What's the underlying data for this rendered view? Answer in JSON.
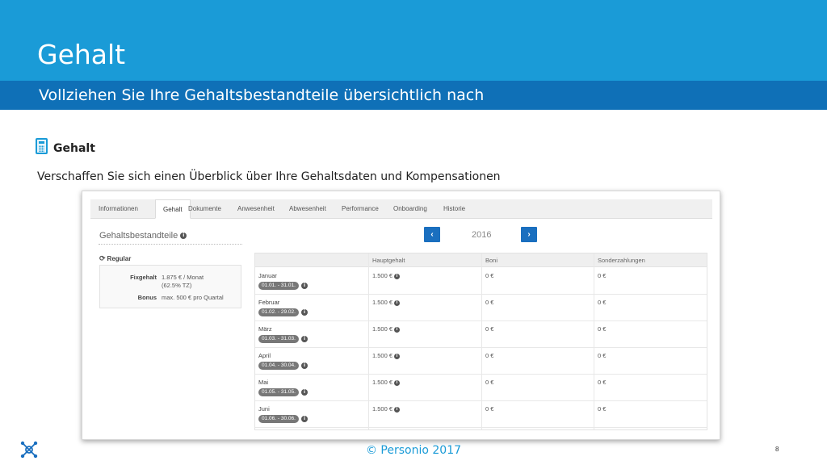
{
  "slide": {
    "title": "Gehalt",
    "subtitle": "Vollziehen Sie Ihre Gehaltsbestandteile übersichtlich nach",
    "section_heading": "Gehalt",
    "section_description": "Verschaffen Sie sich einen Überblick über Ihre Gehaltsdaten und Kompensationen",
    "footer": "© Personio 2017",
    "page_number": "8"
  },
  "colors": {
    "header": "#1a9bd7",
    "subheader": "#0f70b7",
    "nav_button": "#1a6fbf",
    "footer_text": "#1a9bd7"
  },
  "screenshot": {
    "tabs": [
      "Informationen",
      "Gehalt",
      "Dokumente",
      "Anwesenheit",
      "Abwesenheit",
      "Performance",
      "Onboarding",
      "Historie"
    ],
    "active_tab": "Gehalt",
    "panel_title": "Gehaltsbestandteile",
    "regular_label": "Regular",
    "fixgehalt_label": "Fixgehalt",
    "fixgehalt_value": "1.875 € / Monat",
    "fixgehalt_note": "(62.5% TZ)",
    "bonus_label": "Bonus",
    "bonus_value": "max. 500 € pro Quartal",
    "year": "2016",
    "prev_symbol": "‹",
    "next_symbol": "›",
    "columns": [
      "Hauptgehalt",
      "Boni",
      "Sonderzahlungen"
    ],
    "rows": [
      {
        "month": "Januar",
        "range": "01.01. - 31.01.",
        "hauptgehalt": "1.500 €",
        "boni": "0 €",
        "sonder": "0 €"
      },
      {
        "month": "Februar",
        "range": "01.02. - 29.02.",
        "hauptgehalt": "1.500 €",
        "boni": "0 €",
        "sonder": "0 €"
      },
      {
        "month": "März",
        "range": "01.03. - 31.03.",
        "hauptgehalt": "1.500 €",
        "boni": "0 €",
        "sonder": "0 €"
      },
      {
        "month": "April",
        "range": "01.04. - 30.04.",
        "hauptgehalt": "1.500 €",
        "boni": "0 €",
        "sonder": "0 €"
      },
      {
        "month": "Mai",
        "range": "01.05. - 31.05.",
        "hauptgehalt": "1.500 €",
        "boni": "0 €",
        "sonder": "0 €"
      },
      {
        "month": "Juni",
        "range": "01.06. - 30.06.",
        "hauptgehalt": "1.500 €",
        "boni": "0 €",
        "sonder": "0 €"
      }
    ]
  }
}
